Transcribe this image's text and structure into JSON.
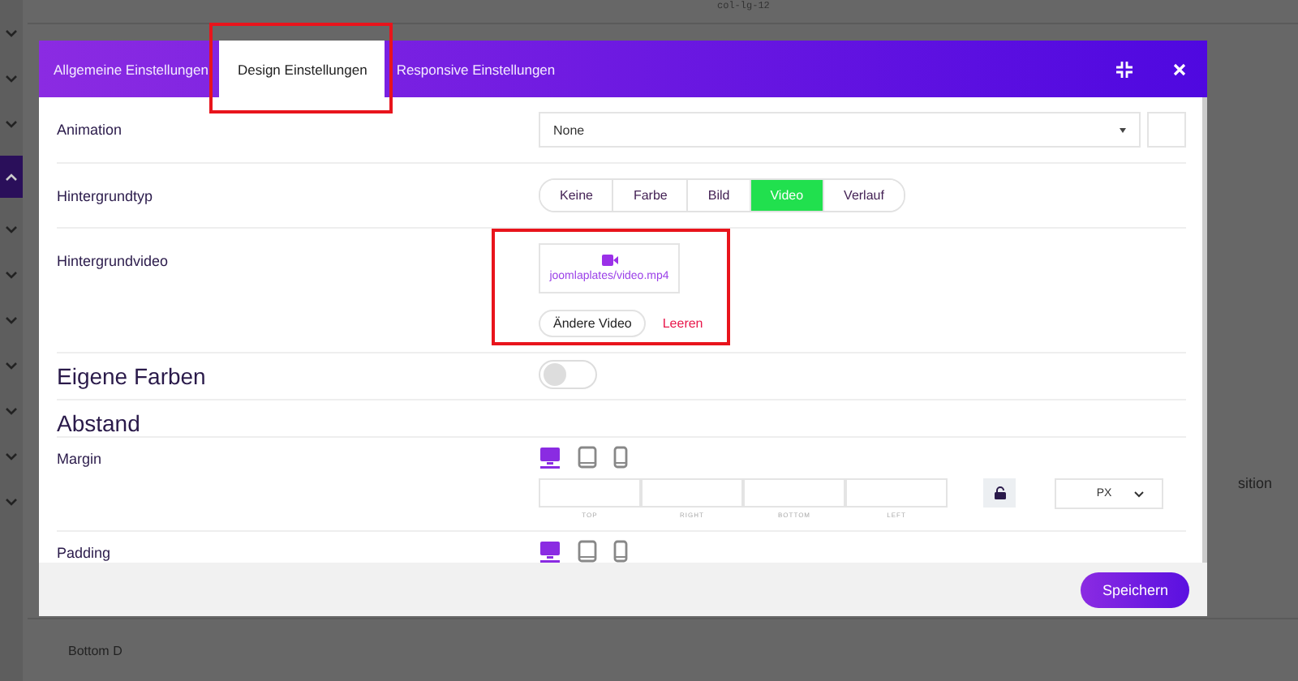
{
  "background": {
    "top_text": "col-lg-12",
    "side_text": "sition",
    "bottom_text": "Bottom D"
  },
  "sidebar": {
    "items": [
      {
        "expanded": false
      },
      {
        "expanded": false
      },
      {
        "expanded": false
      },
      {
        "expanded": true
      },
      {
        "expanded": false
      },
      {
        "expanded": false
      },
      {
        "expanded": false
      },
      {
        "expanded": false
      },
      {
        "expanded": false
      },
      {
        "expanded": false
      },
      {
        "expanded": false
      }
    ]
  },
  "modal": {
    "tabs": [
      {
        "label": "Allgemeine Einstellungen",
        "selected": false,
        "highlighted": false
      },
      {
        "label": "Design Einstellungen",
        "selected": true,
        "highlighted": true
      },
      {
        "label": "Responsive Einstellungen",
        "selected": false,
        "highlighted": false
      }
    ],
    "fields": [
      {
        "kind": "select",
        "label": "Animation",
        "value": "None"
      },
      {
        "kind": "segmented",
        "label": "Hintergrundtyp",
        "options": [
          {
            "label": "Keine",
            "selected": false
          },
          {
            "label": "Farbe",
            "selected": false
          },
          {
            "label": "Bild",
            "selected": false
          },
          {
            "label": "Video",
            "selected": true
          },
          {
            "label": "Verlauf",
            "selected": false
          }
        ]
      },
      {
        "kind": "video",
        "label": "Hintergrundvideo",
        "file": "joomlaplates/video.mp4",
        "change_button": "Ändere Video",
        "clear_button": "Leeren",
        "highlighted": true
      },
      {
        "kind": "toggle",
        "label": "Eigene Farben",
        "on": false
      },
      {
        "kind": "heading",
        "label": "Abstand"
      },
      {
        "kind": "spacing",
        "label": "Margin",
        "devices": [
          {
            "kind": "desktop",
            "selected": true
          },
          {
            "kind": "tablet",
            "selected": false
          },
          {
            "kind": "phone",
            "selected": false
          }
        ],
        "sides": [
          "TOP",
          "RIGHT",
          "BOTTOM",
          "LEFT"
        ],
        "unit": "PX"
      },
      {
        "kind": "spacing",
        "label": "Padding",
        "devices": [
          {
            "kind": "desktop",
            "selected": true
          },
          {
            "kind": "tablet",
            "selected": false
          },
          {
            "kind": "phone",
            "selected": false
          }
        ]
      }
    ],
    "save_button": "Speichern"
  }
}
